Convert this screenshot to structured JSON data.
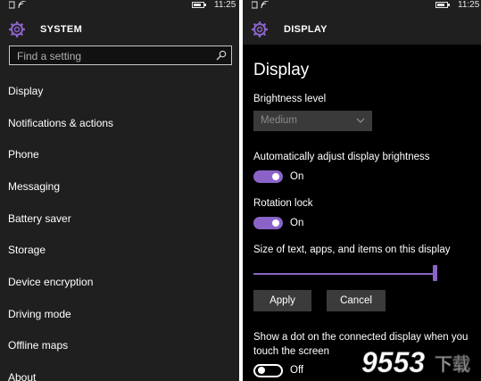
{
  "status": {
    "time": "11:25"
  },
  "left": {
    "header_title": "SYSTEM",
    "search_placeholder": "Find a setting",
    "items": [
      "Display",
      "Notifications & actions",
      "Phone",
      "Messaging",
      "Battery saver",
      "Storage",
      "Device encryption",
      "Driving mode",
      "Offline maps",
      "About"
    ]
  },
  "right": {
    "header_title": "DISPLAY",
    "page_title": "Display",
    "brightness_label": "Brightness level",
    "brightness_value": "Medium",
    "auto_brightness_label": "Automatically adjust display brightness",
    "auto_brightness_state": "On",
    "rotation_label": "Rotation lock",
    "rotation_state": "On",
    "size_label": "Size of text, apps, and items on this display",
    "size_slider_level": 1.0,
    "apply_label": "Apply",
    "cancel_label": "Cancel",
    "dot_label_line1": "Show a dot on the connected display when you",
    "dot_label_line2": "touch the screen",
    "dot_state": "Off"
  },
  "watermark": {
    "text": "9553下载"
  },
  "colors": {
    "accent": "#8b63c8",
    "left_bg": "#1f1f1f",
    "right_bg": "#000000"
  },
  "icons": [
    "signal-icon",
    "battery-icon",
    "gear-icon",
    "search-icon",
    "chevron-down-icon"
  ]
}
